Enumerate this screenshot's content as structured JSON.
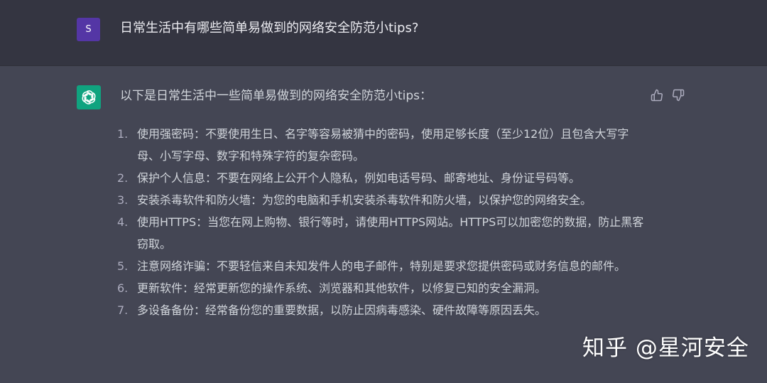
{
  "user_message": {
    "avatar_letter": "S",
    "text": "日常生活中有哪些简单易做到的网络安全防范小tips?"
  },
  "assistant_message": {
    "intro": "以下是日常生活中一些简单易做到的网络安全防范小tips：",
    "items": [
      {
        "num": "1.",
        "text": "使用强密码：不要使用生日、名字等容易被猜中的密码，使用足够长度（至少12位）且包含大写字母、小写字母、数字和特殊字符的复杂密码。"
      },
      {
        "num": "2.",
        "text": "保护个人信息：不要在网络上公开个人隐私，例如电话号码、邮寄地址、身份证号码等。"
      },
      {
        "num": "3.",
        "text": "安装杀毒软件和防火墙：为您的电脑和手机安装杀毒软件和防火墙，以保护您的网络安全。"
      },
      {
        "num": "4.",
        "text": "使用HTTPS：当您在网上购物、银行等时，请使用HTTPS网站。HTTPS可以加密您的数据，防止黑客窃取。"
      },
      {
        "num": "5.",
        "text": "注意网络诈骗：不要轻信来自未知发件人的电子邮件，特别是要求您提供密码或财务信息的邮件。"
      },
      {
        "num": "6.",
        "text": "更新软件：经常更新您的操作系统、浏览器和其他软件，以修复已知的安全漏洞。"
      },
      {
        "num": "7.",
        "text": "多设备备份：经常备份您的重要数据，以防止因病毒感染、硬件故障等原因丢失。"
      }
    ]
  },
  "watermark": "知乎 @星河安全",
  "colors": {
    "user_row_bg": "#343541",
    "assistant_row_bg": "#444654",
    "user_avatar": "#5436a5",
    "bot_avatar": "#10a37f"
  },
  "icons": {
    "bot_avatar": "openai-logo-icon",
    "feedback_up": "thumbs-up-icon",
    "feedback_down": "thumbs-down-icon"
  }
}
